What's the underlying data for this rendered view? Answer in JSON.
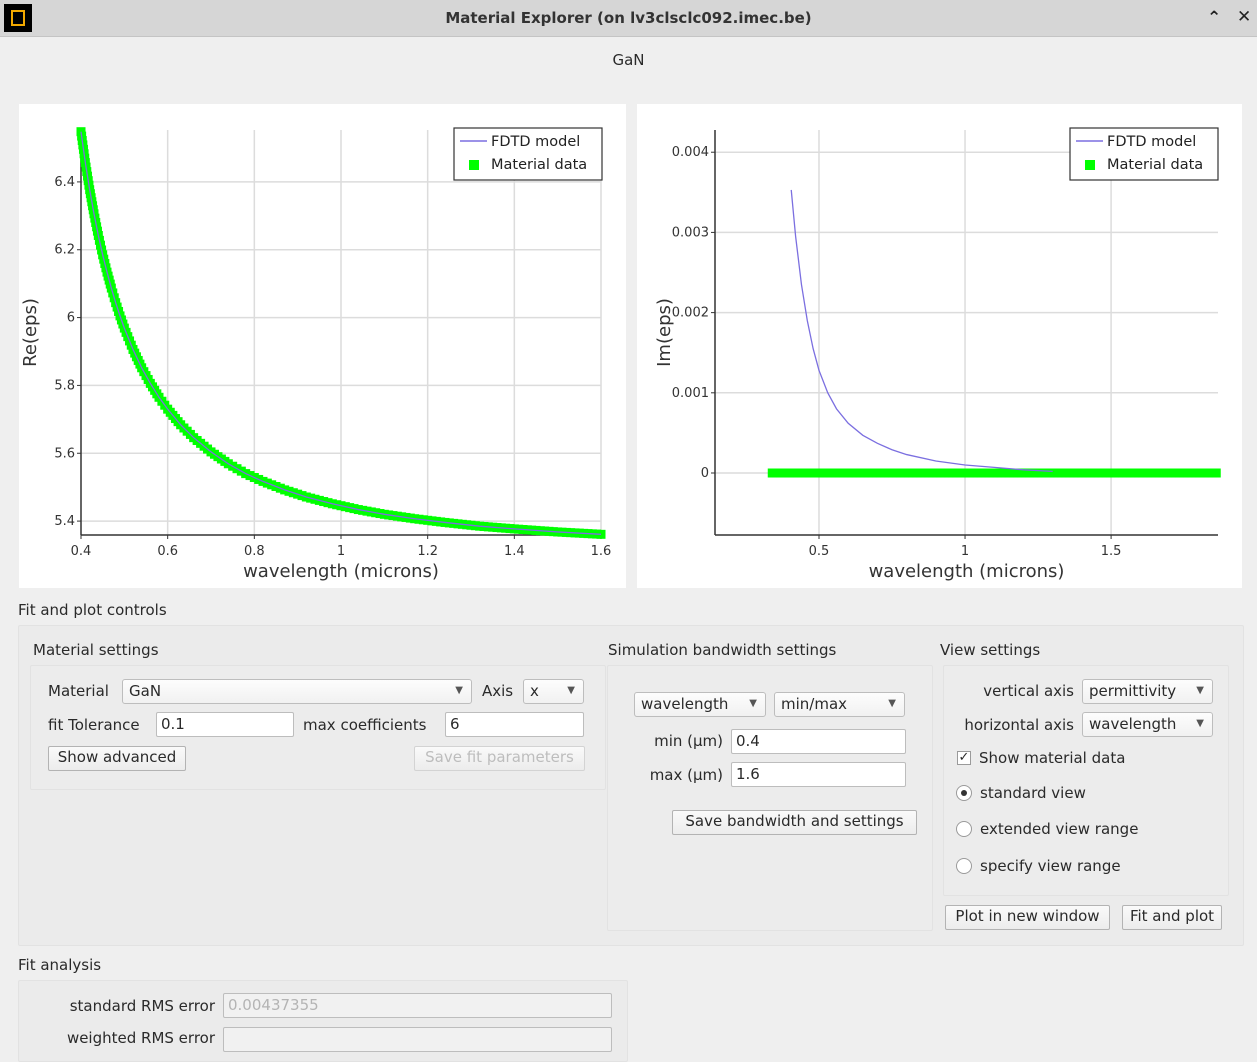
{
  "window": {
    "title": "Material Explorer (on lv3clsclc092.imec.be)",
    "maximize_icon": "chevron-up-icon",
    "close_icon": "close-icon"
  },
  "plot_title": "GaN",
  "chart_data": [
    {
      "type": "line",
      "xlabel": "wavelength (microns)",
      "ylabel": "Re(eps)",
      "xlim": [
        0.4,
        1.6
      ],
      "ylim": [
        5.359,
        6.553
      ],
      "xticks": [
        0.4,
        0.6,
        0.8,
        1,
        1.2,
        1.4,
        1.6
      ],
      "xtick_labels": [
        "0.4",
        "0.6",
        "0.8",
        "1",
        "1.2",
        "1.4",
        "1.6"
      ],
      "yticks": [
        5.4,
        5.6,
        5.8,
        6,
        6.2,
        6.4
      ],
      "ytick_labels": [
        "5.4",
        "5.6",
        "5.8",
        "6",
        "6.2",
        "6.4"
      ],
      "grid": true,
      "legend": {
        "placement": "top-right",
        "entries": [
          "FDTD model",
          "Material data"
        ]
      },
      "series": [
        {
          "name": "FDTD model",
          "style": "line",
          "color": "#7b6fe0",
          "x": [
            0.4,
            0.41,
            0.42,
            0.43,
            0.44,
            0.45,
            0.46,
            0.47,
            0.48,
            0.49,
            0.5,
            0.52,
            0.54,
            0.56,
            0.58,
            0.6,
            0.63,
            0.66,
            0.7,
            0.74,
            0.78,
            0.82,
            0.87,
            0.92,
            0.98,
            1.04,
            1.1,
            1.17,
            1.24,
            1.32,
            1.4,
            1.5,
            1.6
          ],
          "y": [
            6.548,
            6.457,
            6.377,
            6.306,
            6.242,
            6.185,
            6.134,
            6.087,
            6.044,
            6.005,
            5.969,
            5.906,
            5.852,
            5.806,
            5.765,
            5.73,
            5.684,
            5.646,
            5.604,
            5.569,
            5.54,
            5.517,
            5.492,
            5.471,
            5.451,
            5.434,
            5.42,
            5.407,
            5.396,
            5.385,
            5.377,
            5.368,
            5.361
          ]
        },
        {
          "name": "Material data",
          "style": "markers",
          "color": "#00ff00",
          "x": [
            0.4,
            0.41,
            0.42,
            0.43,
            0.44,
            0.45,
            0.46,
            0.47,
            0.48,
            0.49,
            0.5,
            0.52,
            0.54,
            0.56,
            0.58,
            0.6,
            0.63,
            0.66,
            0.7,
            0.74,
            0.78,
            0.82,
            0.87,
            0.92,
            0.98,
            1.04,
            1.1,
            1.17,
            1.24,
            1.32,
            1.4,
            1.5,
            1.6
          ],
          "y": [
            6.548,
            6.457,
            6.377,
            6.306,
            6.242,
            6.185,
            6.134,
            6.087,
            6.044,
            6.005,
            5.969,
            5.906,
            5.852,
            5.806,
            5.765,
            5.73,
            5.684,
            5.646,
            5.604,
            5.569,
            5.54,
            5.517,
            5.492,
            5.471,
            5.451,
            5.434,
            5.42,
            5.407,
            5.396,
            5.385,
            5.377,
            5.368,
            5.361
          ]
        }
      ]
    },
    {
      "type": "line",
      "xlabel": "wavelength (microns)",
      "ylabel": "Im(eps)",
      "xlim": [
        0.144,
        1.866
      ],
      "ylim": [
        -0.000773,
        0.004277
      ],
      "xticks": [
        0.5,
        1,
        1.5
      ],
      "xtick_labels": [
        "0.5",
        "1",
        "1.5"
      ],
      "yticks": [
        0,
        0.001,
        0.002,
        0.003,
        0.004
      ],
      "ytick_labels": [
        "0",
        "0.001",
        "0.002",
        "0.003",
        "0.004"
      ],
      "grid": true,
      "legend": {
        "placement": "top-right",
        "entries": [
          "FDTD model",
          "Material data"
        ]
      },
      "series": [
        {
          "name": "FDTD model",
          "style": "line",
          "color": "#7b6fe0",
          "x": [
            0.405,
            0.42,
            0.44,
            0.46,
            0.48,
            0.5,
            0.53,
            0.56,
            0.6,
            0.65,
            0.7,
            0.75,
            0.8,
            0.9,
            1.0,
            1.1,
            1.2,
            1.3
          ],
          "y": [
            0.00353,
            0.00295,
            0.00235,
            0.0019,
            0.00155,
            0.00128,
            0.001,
            0.0008,
            0.00062,
            0.00047,
            0.00037,
            0.00029,
            0.00023,
            0.00015,
            0.0001,
            7e-05,
            4e-05,
            2e-05
          ]
        },
        {
          "name": "Material data",
          "style": "markers",
          "color": "#00ff00",
          "x": [
            0.34,
            0.6,
            1.0,
            1.4,
            1.86
          ],
          "y": [
            0,
            0,
            0,
            0,
            0
          ]
        }
      ]
    }
  ],
  "controls": {
    "section_title": "Fit and plot controls",
    "material_settings": {
      "title": "Material settings",
      "material_label": "Material",
      "material_value": "GaN",
      "axis_label": "Axis",
      "axis_value": "x",
      "tolerance_label": "fit Tolerance",
      "tolerance_value": "0.1",
      "max_coeff_label": "max coefficients",
      "max_coeff_value": "6",
      "show_advanced": "Show advanced",
      "save_fit": "Save fit parameters"
    },
    "bandwidth": {
      "title": "Simulation bandwidth settings",
      "unit_value": "wavelength",
      "mode_value": "min/max",
      "min_label": "min (µm)",
      "min_value": "0.4",
      "max_label": "max (µm)",
      "max_value": "1.6",
      "save": "Save bandwidth and settings"
    },
    "view": {
      "title": "View settings",
      "vertical_label": "vertical axis",
      "vertical_value": "permittivity",
      "horizontal_label": "horizontal axis",
      "horizontal_value": "wavelength",
      "show_material": "Show material data",
      "show_material_checked": true,
      "standard": "standard view",
      "extended": "extended view range",
      "specify": "specify view range",
      "selected": "standard view",
      "plot_new": "Plot in new window",
      "fit_plot": "Fit and plot"
    }
  },
  "fit_analysis": {
    "title": "Fit analysis",
    "rms_label": "standard RMS error",
    "rms_value": "0.00437355",
    "weighted_label": "weighted RMS error"
  }
}
